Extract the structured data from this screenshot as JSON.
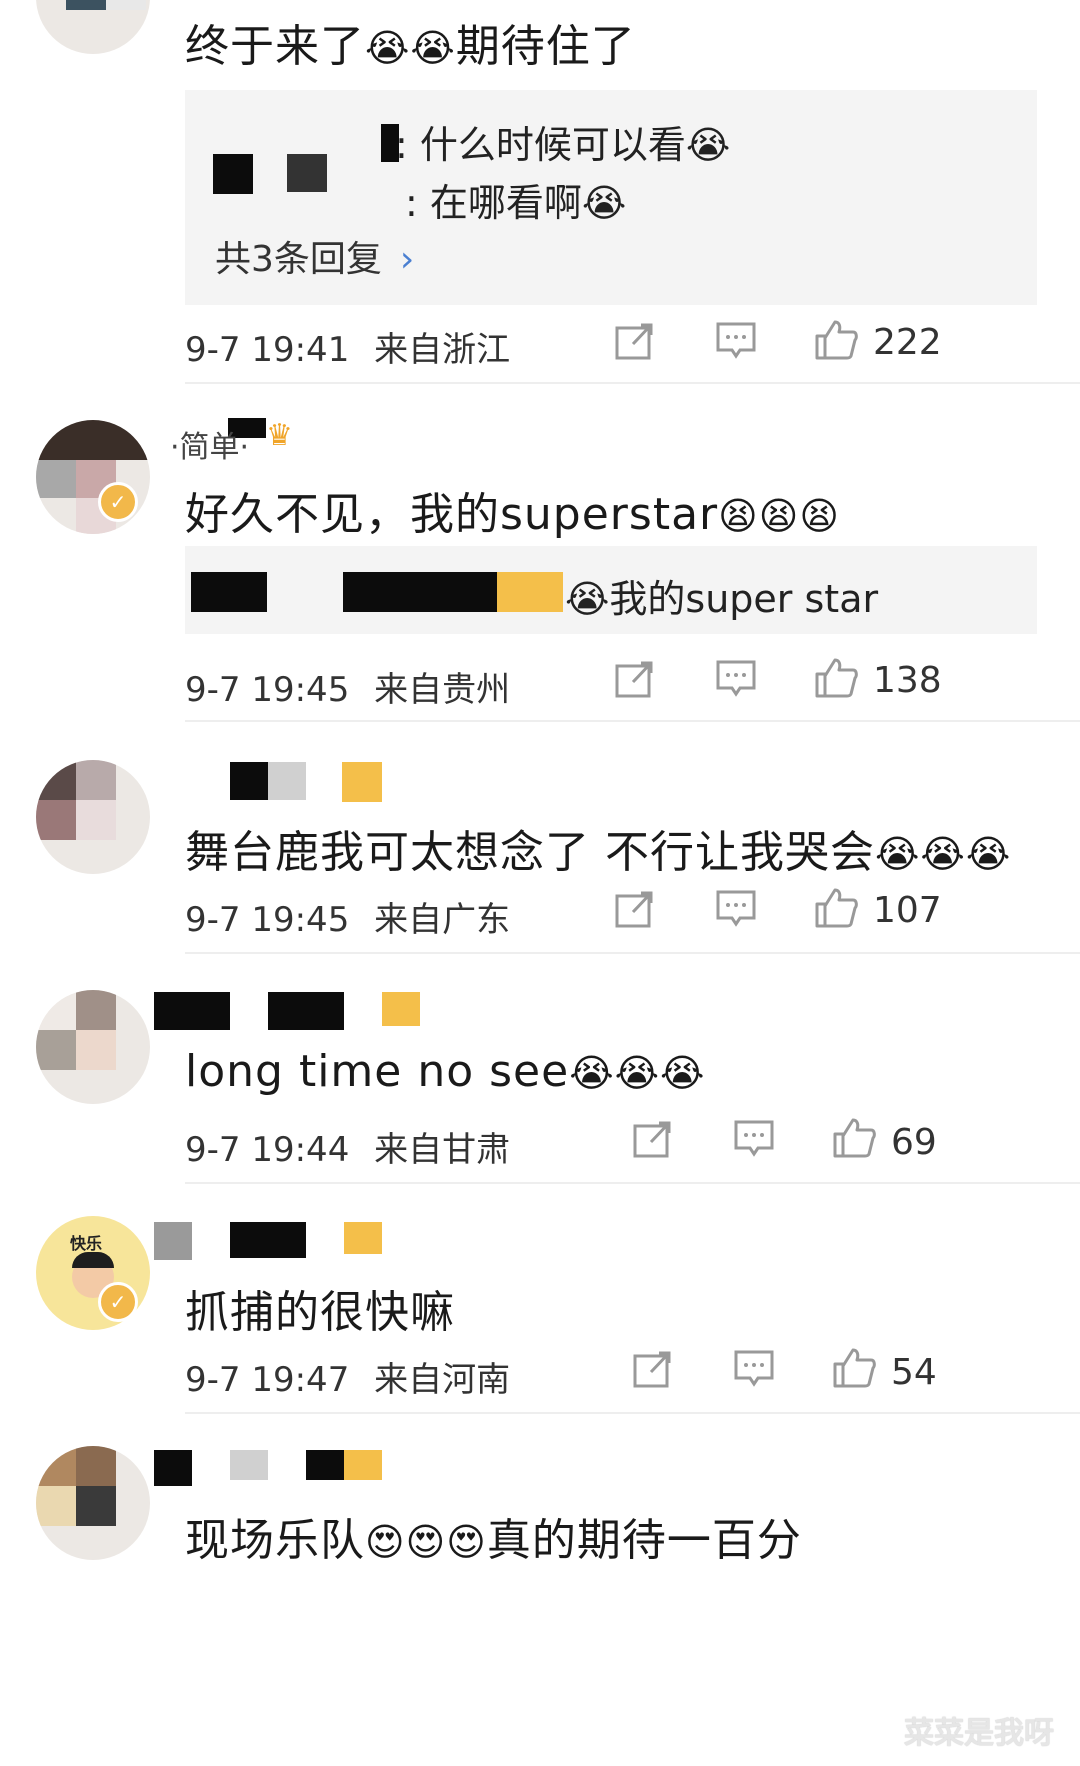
{
  "comments": [
    {
      "text": "终于来了",
      "text_after_emoji": "期待住了",
      "emojis_after_text": [
        "crying-emoji",
        "crying-emoji"
      ],
      "replies": [
        {
          "text": ": 什么时候可以看"
        },
        {
          "text": ": 在哪看啊"
        }
      ],
      "more_replies": "共3条回复",
      "time": "9-7 19:41",
      "location": "来自浙江",
      "likes": "222"
    },
    {
      "username": "·简单·",
      "text": "好久不见，我的superstar",
      "replies": [
        {
          "text": "我的super star"
        }
      ],
      "time": "9-7 19:45",
      "location": "来自贵州",
      "likes": "138"
    },
    {
      "text": "舞台鹿我可太想念了 不行让我哭会",
      "time": "9-7 19:45",
      "location": "来自广东",
      "likes": "107"
    },
    {
      "text": "long time no see",
      "time": "9-7 19:44",
      "location": "来自甘肃",
      "likes": "69"
    },
    {
      "avatar_text": "快乐",
      "text": "抓捕的很快嘛",
      "time": "9-7 19:47",
      "location": "来自河南",
      "likes": "54"
    },
    {
      "text": "现场乐队",
      "text_after_emoji": "真的期待一百分"
    }
  ],
  "watermark": "菜菜是我呀",
  "icons": {
    "share": "share-icon",
    "comment": "comment-icon",
    "like": "thumbs-up-icon",
    "verified": "verified-badge-icon"
  },
  "colors": {
    "reply_bg": "#f4f4f4",
    "verified": "#f2b84a",
    "chevron": "#4a7fd1"
  }
}
